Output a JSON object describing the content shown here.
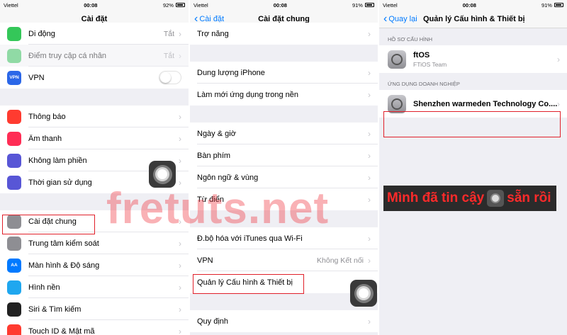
{
  "status": {
    "s1": {
      "carrier": "Viettel",
      "time": "00:08",
      "battery": "92%"
    },
    "s2": {
      "carrier": "Viettel",
      "time": "00:08",
      "battery": "91%"
    },
    "s3": {
      "carrier": "Viettel",
      "time": "00:08",
      "battery": "91%"
    }
  },
  "screen1": {
    "title": "Cài đặt",
    "group1": [
      {
        "label": "Di động",
        "value": "Tắt",
        "icon": "antenna-icon",
        "color": "#34c759"
      },
      {
        "label": "Điểm truy cập cá nhân",
        "value": "Tắt",
        "icon": "hotspot-icon",
        "color": "#34c759"
      },
      {
        "label": "VPN",
        "icon": "vpn-icon",
        "color": "#2b67e8",
        "icon_text": "VPN"
      }
    ],
    "group2": [
      {
        "label": "Thông báo",
        "icon": "notification-icon",
        "color": "#ff3b30"
      },
      {
        "label": "Âm thanh",
        "icon": "sound-icon",
        "color": "#ff2d55"
      },
      {
        "label": "Không làm phiền",
        "icon": "moon-icon",
        "color": "#5856d6"
      },
      {
        "label": "Thời gian sử dụng",
        "icon": "hourglass-icon",
        "color": "#5856d6"
      }
    ],
    "group3": [
      {
        "label": "Cài đặt chung",
        "icon": "gear-icon",
        "color": "#8e8e93"
      },
      {
        "label": "Trung tâm kiểm soát",
        "icon": "control-center-icon",
        "color": "#8e8e93"
      },
      {
        "label": "Màn hình & Độ sáng",
        "icon": "display-icon",
        "color": "#007aff",
        "icon_text": "AA"
      },
      {
        "label": "Hình nền",
        "icon": "wallpaper-icon",
        "color": "#1fa7ef"
      },
      {
        "label": "Siri & Tìm kiếm",
        "icon": "siri-icon",
        "color": "#222222"
      },
      {
        "label": "Touch ID & Mật mã",
        "icon": "fingerprint-icon",
        "color": "#ff3b30"
      }
    ]
  },
  "screen2": {
    "back": "Cài đặt",
    "title": "Cài đặt chung",
    "group1": [
      {
        "label": "Trợ năng"
      }
    ],
    "group2": [
      {
        "label": "Dung lượng iPhone"
      },
      {
        "label": "Làm mới ứng dụng trong nền"
      }
    ],
    "group3": [
      {
        "label": "Ngày & giờ"
      },
      {
        "label": "Bàn phím"
      },
      {
        "label": "Ngôn ngữ & vùng"
      },
      {
        "label": "Từ điển"
      }
    ],
    "group4": [
      {
        "label": "Đ.bộ hóa với iTunes qua Wi-Fi"
      },
      {
        "label": "VPN",
        "value": "Không Kết nối"
      },
      {
        "label": "Quản lý Cấu hình & Thiết bị"
      }
    ],
    "group5": [
      {
        "label": "Quy định"
      }
    ]
  },
  "screen3": {
    "back": "Quay lại",
    "title": "Quản lý Cấu hình & Thiết bị",
    "section1": "HỒ SƠ CẤU HÌNH",
    "profile": {
      "name": "ftOS",
      "sub": "FTiOS Team"
    },
    "section2": "ỨNG DỤNG DOANH NGHIỆP",
    "enterprise": {
      "name": "Shenzhen warmeden Technology Co...."
    }
  },
  "watermark": "fretuts.net",
  "caption": {
    "before": "Mình đã tin cậy",
    "after": "sẵn rồi"
  }
}
